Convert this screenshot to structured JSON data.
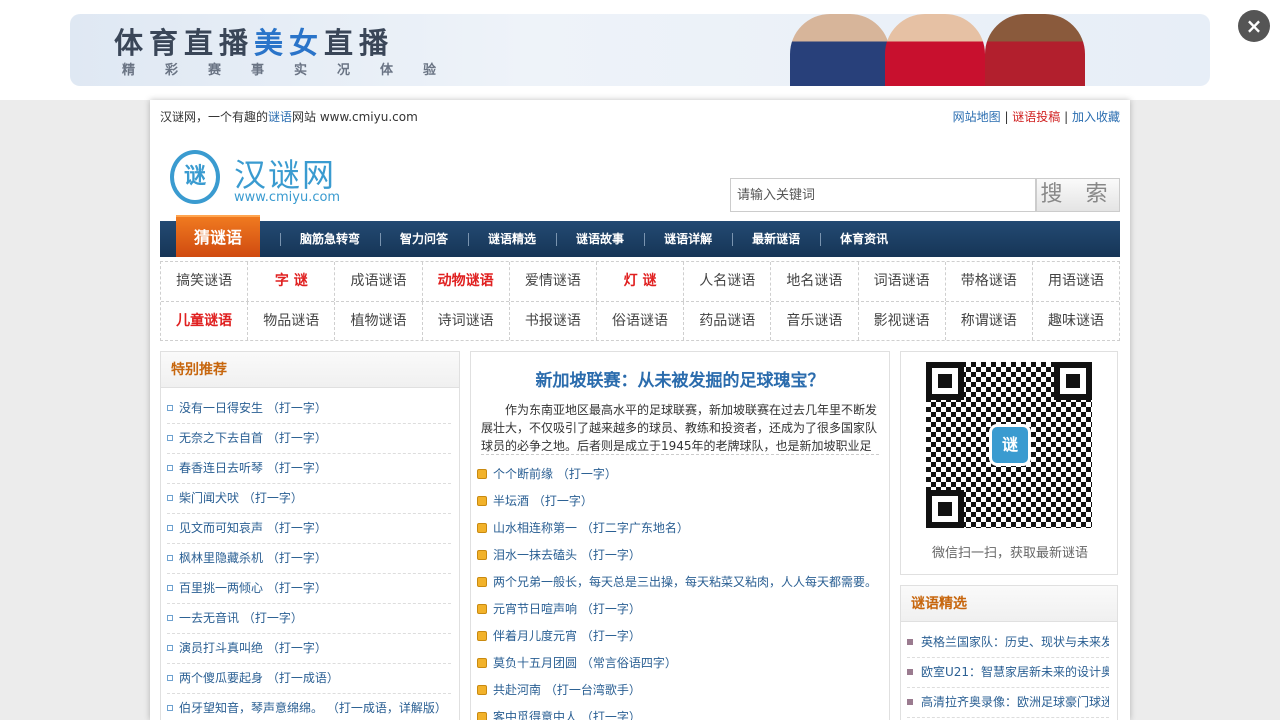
{
  "ad": {
    "title_part1": "体育直播",
    "title_part2": "美女",
    "title_part3": "直播",
    "subtitle": "精彩赛事实况体验",
    "close_label": "×"
  },
  "topbar": {
    "intro_prefix": "汉谜网，一个有趣的",
    "intro_link": "谜语",
    "intro_suffix": "网站 www.cmiyu.com",
    "sitemap": "网站地图",
    "sep1": " | ",
    "submit": "谜语投稿",
    "sep2": " | ",
    "favorite": "加入收藏"
  },
  "logo": {
    "mark": "谜",
    "name": "汉谜网",
    "url": "www.cmiyu.com"
  },
  "search": {
    "placeholder": "请输入关键词",
    "button": "搜 索"
  },
  "nav": {
    "main": "猜谜语",
    "items": [
      "脑筋急转弯",
      "智力问答",
      "谜语精选",
      "谜语故事",
      "谜语详解",
      "最新谜语",
      "体育资讯"
    ]
  },
  "categories": {
    "row1": [
      "搞笑谜语",
      "字 谜",
      "成语谜语",
      "动物谜语",
      "爱情谜语",
      "灯 谜",
      "人名谜语",
      "地名谜语",
      "词语谜语",
      "带格谜语",
      "用语谜语"
    ],
    "row2": [
      "儿童谜语",
      "物品谜语",
      "植物谜语",
      "诗词谜语",
      "书报谜语",
      "俗语谜语",
      "药品谜语",
      "音乐谜语",
      "影视谜语",
      "称谓谜语",
      "趣味谜语"
    ]
  },
  "special": {
    "heading": "特别推荐",
    "items": [
      "没有一日得安生 （打一字）",
      "无奈之下去自首 （打一字）",
      "春香连日去听琴 （打一字）",
      "柴门闻犬吠 （打一字）",
      "见文而可知哀声 （打一字）",
      "枫林里隐藏杀机 （打一字）",
      "百里挑一两倾心 （打一字）",
      "一去无音讯 （打一字）",
      "演员打斗真叫绝 （打一字）",
      "两个傻瓜要起身 （打一成语）",
      "伯牙望知音，琴声意绵绵。 （打一成语，详解版）"
    ]
  },
  "article": {
    "title": "新加坡联赛：从未被发掘的足球瑰宝？",
    "text": "作为东南亚地区最高水平的足球联赛，新加坡联赛在过去几年里不断发展壮大，不仅吸引了越来越多的球员、教练和投资者，还成为了很多国家队球员的必争之地。后者则是成立于1945年的老牌球队，也是新加坡职业足"
  },
  "riddles": [
    "个个断前缘 （打一字）",
    "半坛酒 （打一字）",
    "山水相连称第一 （打二字广东地名）",
    "泪水一抹去磕头 （打一字）",
    "两个兄弟一般长，每天总是三出操，每天粘菜又粘肉，人人每天都需要。",
    "元宵节日喧声响 （打一字）",
    "伴着月儿度元宵 （打一字）",
    "莫负十五月团圆 （常言俗语四字）",
    "共赴河南 （打一台湾歌手）",
    "客中觅得意中人 （打一字）"
  ],
  "qr": {
    "logo": "谜",
    "caption": "微信扫一扫，获取最新谜语"
  },
  "picks": {
    "heading": "谜语精选",
    "items": [
      "英格兰国家队：历史、现状与未来发",
      "欧室U21：智慧家居新未来的设计奥",
      "高清拉齐奥录像：欧洲足球豪门球迷"
    ]
  }
}
